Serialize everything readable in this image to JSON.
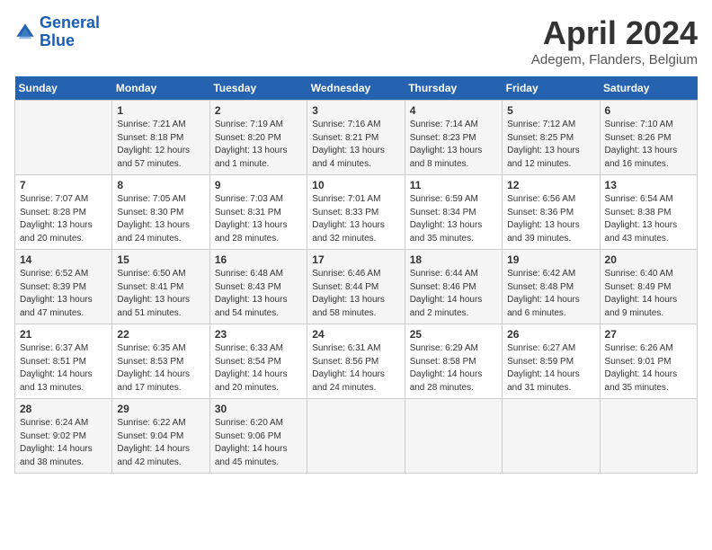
{
  "header": {
    "logo_line1": "General",
    "logo_line2": "Blue",
    "month_title": "April 2024",
    "location": "Adegem, Flanders, Belgium"
  },
  "weekdays": [
    "Sunday",
    "Monday",
    "Tuesday",
    "Wednesday",
    "Thursday",
    "Friday",
    "Saturday"
  ],
  "weeks": [
    [
      {
        "day": "",
        "detail": ""
      },
      {
        "day": "1",
        "detail": "Sunrise: 7:21 AM\nSunset: 8:18 PM\nDaylight: 12 hours\nand 57 minutes."
      },
      {
        "day": "2",
        "detail": "Sunrise: 7:19 AM\nSunset: 8:20 PM\nDaylight: 13 hours\nand 1 minute."
      },
      {
        "day": "3",
        "detail": "Sunrise: 7:16 AM\nSunset: 8:21 PM\nDaylight: 13 hours\nand 4 minutes."
      },
      {
        "day": "4",
        "detail": "Sunrise: 7:14 AM\nSunset: 8:23 PM\nDaylight: 13 hours\nand 8 minutes."
      },
      {
        "day": "5",
        "detail": "Sunrise: 7:12 AM\nSunset: 8:25 PM\nDaylight: 13 hours\nand 12 minutes."
      },
      {
        "day": "6",
        "detail": "Sunrise: 7:10 AM\nSunset: 8:26 PM\nDaylight: 13 hours\nand 16 minutes."
      }
    ],
    [
      {
        "day": "7",
        "detail": "Sunrise: 7:07 AM\nSunset: 8:28 PM\nDaylight: 13 hours\nand 20 minutes."
      },
      {
        "day": "8",
        "detail": "Sunrise: 7:05 AM\nSunset: 8:30 PM\nDaylight: 13 hours\nand 24 minutes."
      },
      {
        "day": "9",
        "detail": "Sunrise: 7:03 AM\nSunset: 8:31 PM\nDaylight: 13 hours\nand 28 minutes."
      },
      {
        "day": "10",
        "detail": "Sunrise: 7:01 AM\nSunset: 8:33 PM\nDaylight: 13 hours\nand 32 minutes."
      },
      {
        "day": "11",
        "detail": "Sunrise: 6:59 AM\nSunset: 8:34 PM\nDaylight: 13 hours\nand 35 minutes."
      },
      {
        "day": "12",
        "detail": "Sunrise: 6:56 AM\nSunset: 8:36 PM\nDaylight: 13 hours\nand 39 minutes."
      },
      {
        "day": "13",
        "detail": "Sunrise: 6:54 AM\nSunset: 8:38 PM\nDaylight: 13 hours\nand 43 minutes."
      }
    ],
    [
      {
        "day": "14",
        "detail": "Sunrise: 6:52 AM\nSunset: 8:39 PM\nDaylight: 13 hours\nand 47 minutes."
      },
      {
        "day": "15",
        "detail": "Sunrise: 6:50 AM\nSunset: 8:41 PM\nDaylight: 13 hours\nand 51 minutes."
      },
      {
        "day": "16",
        "detail": "Sunrise: 6:48 AM\nSunset: 8:43 PM\nDaylight: 13 hours\nand 54 minutes."
      },
      {
        "day": "17",
        "detail": "Sunrise: 6:46 AM\nSunset: 8:44 PM\nDaylight: 13 hours\nand 58 minutes."
      },
      {
        "day": "18",
        "detail": "Sunrise: 6:44 AM\nSunset: 8:46 PM\nDaylight: 14 hours\nand 2 minutes."
      },
      {
        "day": "19",
        "detail": "Sunrise: 6:42 AM\nSunset: 8:48 PM\nDaylight: 14 hours\nand 6 minutes."
      },
      {
        "day": "20",
        "detail": "Sunrise: 6:40 AM\nSunset: 8:49 PM\nDaylight: 14 hours\nand 9 minutes."
      }
    ],
    [
      {
        "day": "21",
        "detail": "Sunrise: 6:37 AM\nSunset: 8:51 PM\nDaylight: 14 hours\nand 13 minutes."
      },
      {
        "day": "22",
        "detail": "Sunrise: 6:35 AM\nSunset: 8:53 PM\nDaylight: 14 hours\nand 17 minutes."
      },
      {
        "day": "23",
        "detail": "Sunrise: 6:33 AM\nSunset: 8:54 PM\nDaylight: 14 hours\nand 20 minutes."
      },
      {
        "day": "24",
        "detail": "Sunrise: 6:31 AM\nSunset: 8:56 PM\nDaylight: 14 hours\nand 24 minutes."
      },
      {
        "day": "25",
        "detail": "Sunrise: 6:29 AM\nSunset: 8:58 PM\nDaylight: 14 hours\nand 28 minutes."
      },
      {
        "day": "26",
        "detail": "Sunrise: 6:27 AM\nSunset: 8:59 PM\nDaylight: 14 hours\nand 31 minutes."
      },
      {
        "day": "27",
        "detail": "Sunrise: 6:26 AM\nSunset: 9:01 PM\nDaylight: 14 hours\nand 35 minutes."
      }
    ],
    [
      {
        "day": "28",
        "detail": "Sunrise: 6:24 AM\nSunset: 9:02 PM\nDaylight: 14 hours\nand 38 minutes."
      },
      {
        "day": "29",
        "detail": "Sunrise: 6:22 AM\nSunset: 9:04 PM\nDaylight: 14 hours\nand 42 minutes."
      },
      {
        "day": "30",
        "detail": "Sunrise: 6:20 AM\nSunset: 9:06 PM\nDaylight: 14 hours\nand 45 minutes."
      },
      {
        "day": "",
        "detail": ""
      },
      {
        "day": "",
        "detail": ""
      },
      {
        "day": "",
        "detail": ""
      },
      {
        "day": "",
        "detail": ""
      }
    ]
  ]
}
